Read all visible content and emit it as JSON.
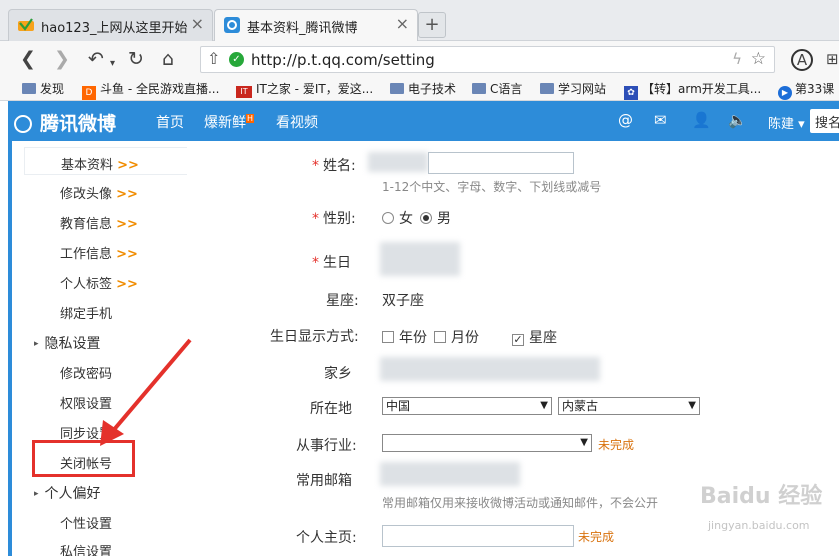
{
  "browser": {
    "tabs": [
      {
        "title": "hao123_上网从这里开始",
        "icon": "hao123-icon",
        "active": false
      },
      {
        "title": "基本资料_腾讯微博",
        "icon": "qq-weibo-icon",
        "active": true
      }
    ],
    "new_tab": "+",
    "url": "http://p.t.qq.com/setting",
    "bookmarks": [
      "发现",
      "斗鱼 - 全民游戏直播...",
      "IT之家 - 爱IT，爱这...",
      "电子技术",
      "C语言",
      "学习网站",
      "【转】arm开发工具...",
      "第33课"
    ]
  },
  "weibo": {
    "brand": "腾讯微博",
    "nav": [
      "首页",
      "爆新鲜",
      "看视频"
    ],
    "hot_badge": "H",
    "user": "陈建",
    "search_placeholder": "搜名"
  },
  "sidebar": {
    "items": [
      {
        "label": "基本资料",
        "chev": ">>",
        "active": true
      },
      {
        "label": "修改头像",
        "chev": ">>"
      },
      {
        "label": "教育信息",
        "chev": ">>"
      },
      {
        "label": "工作信息",
        "chev": ">>"
      },
      {
        "label": "个人标签",
        "chev": ">>"
      },
      {
        "label": "绑定手机",
        "chev": ""
      }
    ],
    "privacy_group": "隐私设置",
    "privacy_items": [
      "修改密码",
      "权限设置",
      "同步设置",
      "关闭帐号"
    ],
    "pref_group": "个人偏好",
    "pref_items": [
      "个性设置",
      "私信设置"
    ]
  },
  "form": {
    "name_label": "姓名:",
    "name_hint": "1-12个中文、字母、数字、下划线或减号",
    "gender_label": "性别:",
    "gender_options": [
      "女",
      "男"
    ],
    "gender_selected": "男",
    "birthday_label": "生日",
    "zodiac_label": "星座:",
    "zodiac_value": "双子座",
    "bday_display_label": "生日显示方式:",
    "bday_display_options": [
      "年份",
      "月份",
      "星座"
    ],
    "bday_display_checked": [
      "星座"
    ],
    "hometown_label": "家乡",
    "location_label": "所在地",
    "location_country": "中国",
    "location_province": "内蒙古",
    "industry_label": "从事行业:",
    "industry_status": "未完成",
    "email_label": "常用邮箱",
    "email_hint": "常用邮箱仅用来接收微博活动或通知邮件，不会公开",
    "homepage_label": "个人主页:",
    "homepage_status": "未完成"
  },
  "watermark": {
    "main": "Baidu 经验",
    "sub": "jingyan.baidu.com"
  },
  "colors": {
    "weibo_blue": "#2d8cd9",
    "required_red": "#e4312b",
    "status_orange": "#d9730f",
    "annotation_red": "#e4312b"
  }
}
